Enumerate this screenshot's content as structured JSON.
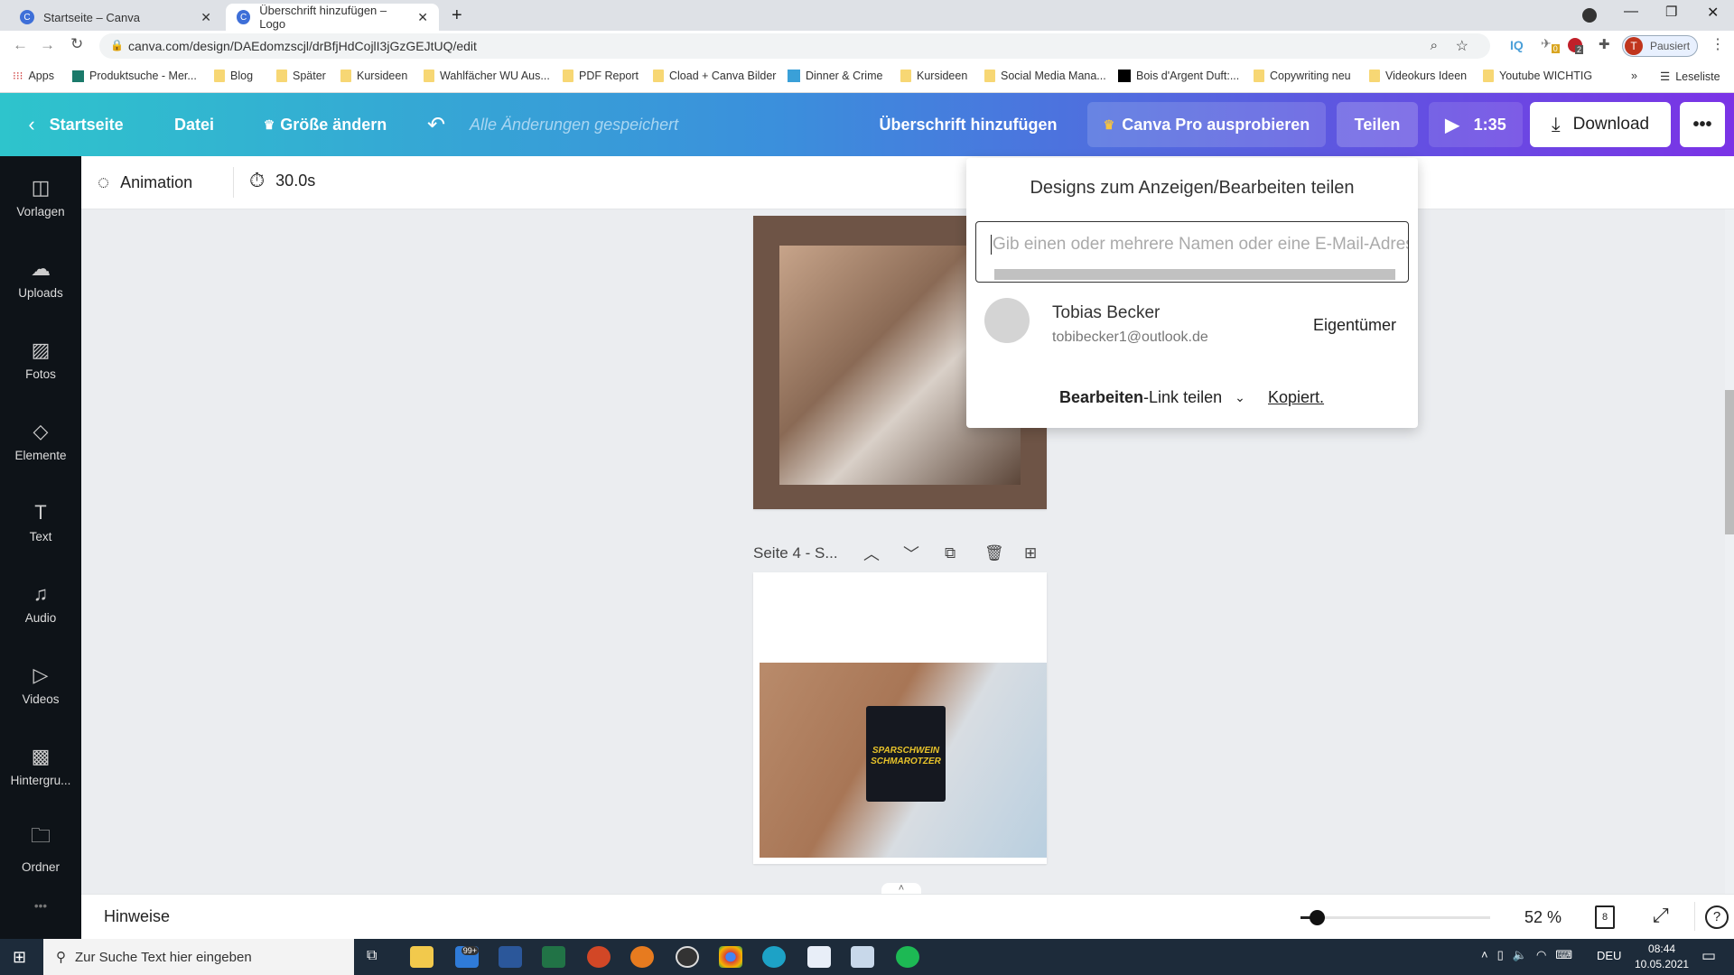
{
  "browser": {
    "tabs": [
      {
        "title": "Startseite – Canva"
      },
      {
        "title": "Überschrift hinzufügen – Logo"
      }
    ],
    "url": "canva.com/design/DAEdomzscjl/drBfjHdCojlI3jGzGEJtUQ/edit",
    "profile_initial": "T",
    "profile_status": "Pausiert",
    "ext_badge_1": "0",
    "ext_badge_2": "2",
    "ext_iq": "IQ",
    "bookmarks": [
      "Apps",
      "Produktsuche - Mer...",
      "Blog",
      "Später",
      "Kursideen",
      "Wahlfächer WU Aus...",
      "PDF Report",
      "Cload + Canva Bilder",
      "Dinner & Crime",
      "Kursideen",
      "Social Media Mana...",
      "Bois d'Argent Duft:...",
      "Copywriting neu",
      "Videokurs Ideen",
      "Youtube WICHTIG"
    ],
    "reading_list": "Leseliste"
  },
  "header": {
    "home": "Startseite",
    "file": "Datei",
    "resize": "Größe ändern",
    "saved": "Alle Änderungen gespeichert",
    "title": "Überschrift hinzufügen",
    "pro": "Canva Pro ausprobieren",
    "share": "Teilen",
    "play_time": "1:35",
    "download": "Download"
  },
  "sidebar": {
    "items": [
      {
        "label": "Vorlagen"
      },
      {
        "label": "Uploads"
      },
      {
        "label": "Fotos"
      },
      {
        "label": "Elemente"
      },
      {
        "label": "Text"
      },
      {
        "label": "Audio"
      },
      {
        "label": "Videos"
      },
      {
        "label": "Hintergru..."
      },
      {
        "label": "Ordner"
      }
    ]
  },
  "toolbar": {
    "animation": "Animation",
    "duration": "30.0s"
  },
  "page4": {
    "label": "Seite 4 - S...",
    "mug_text_1": "SPARSCHWEIN",
    "mug_text_2": "SCHMAROTZER"
  },
  "share_popup": {
    "title": "Designs zum Anzeigen/Bearbeiten teilen",
    "input_placeholder": "Gib einen oder mehrere Namen oder eine E-Mail-Adresse ein",
    "user_name": "Tobias Becker",
    "user_email": "tobibecker1@outlook.de",
    "role": "Eigentümer",
    "link_bold": "Bearbeiten",
    "link_rest": "-Link teilen",
    "copied": "Kopiert."
  },
  "bottom": {
    "notes": "Hinweise",
    "zoom": "52 %",
    "zoom_value": 52,
    "pages": "8"
  },
  "taskbar": {
    "search_placeholder": "Zur Suche Text hier eingeben",
    "mail_badge": "99+",
    "lang": "DEU",
    "time": "08:44",
    "date": "10.05.2021"
  },
  "colors": {
    "accent": "#7b33e6",
    "teal": "#2ec4cc",
    "sidebar": "#0e1318"
  }
}
